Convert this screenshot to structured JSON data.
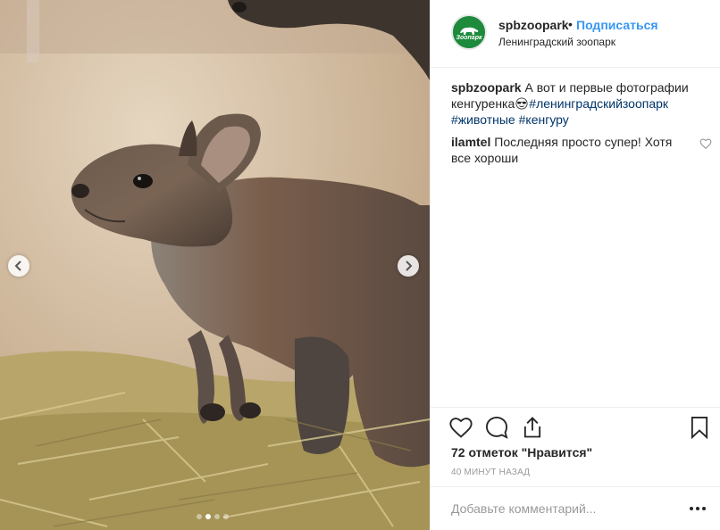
{
  "photo": {
    "alt": "",
    "carousel": {
      "total": 4,
      "active_index": 1
    }
  },
  "header": {
    "username": "spbzoopark",
    "separator": "•",
    "follow_label": "Подписаться",
    "location": "Ленинградский зоопарк",
    "avatar_text": "Зоопарк"
  },
  "caption": {
    "username": "spbzoopark",
    "text_before": "А вот и первые фотографии кенгуренка",
    "emoji": "😎",
    "tags": [
      "#ленинградскийзоопарк",
      "#животные",
      "#кенгуру"
    ]
  },
  "comments": [
    {
      "username": "ilamtel",
      "text": "Последняя просто супер! Хотя все хороши"
    }
  ],
  "likes_text": "72 отметок \"Нравится\"",
  "timestamp": "40 МИНУТ НАЗАД",
  "add_comment": {
    "placeholder": "Добавьте комментарий..."
  },
  "colors": {
    "accent": "#3897f0",
    "hashtag": "#003569",
    "border": "#efefef",
    "avatar_bg": "#1d8a3c"
  }
}
